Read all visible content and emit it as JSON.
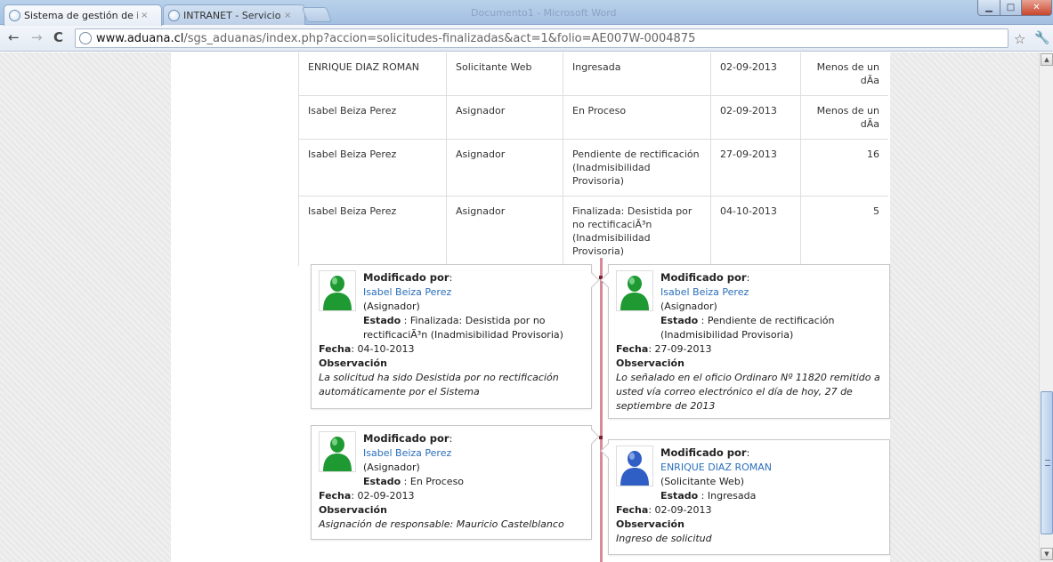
{
  "browser": {
    "tabs": [
      {
        "title": "Sistema de gestión de infor",
        "close": "×"
      },
      {
        "title": "INTRANET - Servicio Nacio",
        "close": "×"
      }
    ],
    "ghost_title": "Documento1 - Microsoft Word",
    "window_controls": {
      "minimize": "▁",
      "maximize": "□",
      "close": "✕"
    },
    "url_domain": "www.aduana.cl",
    "url_path": "/sgs_aduanas/index.php?accion=solicitudes-finalizadas&act=1&folio=AE007W-0004875",
    "icons": [
      "back-icon",
      "forward-icon",
      "reload-icon",
      "globe-icon",
      "star-icon",
      "wrench-icon"
    ]
  },
  "history_table": {
    "rows": [
      {
        "name": "ENRIQUE DIAZ ROMAN",
        "role": "Solicitante Web",
        "state": "Ingresada",
        "date": "02-09-2013",
        "days": "Menos de un dÃ­a"
      },
      {
        "name": "Isabel Beiza Perez",
        "role": "Asignador",
        "state": "En Proceso",
        "date": "02-09-2013",
        "days": "Menos de un dÃ­a"
      },
      {
        "name": "Isabel Beiza Perez",
        "role": "Asignador",
        "state": "Pendiente de rectificación (Inadmisibilidad Provisoria)",
        "date": "27-09-2013",
        "days": "16"
      },
      {
        "name": "Isabel Beiza Perez",
        "role": "Asignador",
        "state": "Finalizada: Desistida por no rectificaciÃ³n (Inadmisibilidad Provisoria)",
        "date": "04-10-2013",
        "days": "5"
      }
    ]
  },
  "timeline": {
    "labels": {
      "modified_by": "Modificado por",
      "estado": "Estado",
      "fecha": "Fecha",
      "observacion": "Observación"
    },
    "entries": [
      {
        "user": "Isabel Beiza Perez",
        "role": "(Asignador)",
        "estado": "Finalizada: Desistida por no rectificaciÃ³n (Inadmisibilidad Provisoria)",
        "fecha": "04-10-2013",
        "observacion": "La solicitud ha sido Desistida por no rectificación automáticamente por el Sistema",
        "avatar": "green-user-icon"
      },
      {
        "user": "Isabel Beiza Perez",
        "role": "(Asignador)",
        "estado": "Pendiente de rectificación (Inadmisibilidad Provisoria)",
        "fecha": "27-09-2013",
        "observacion": "Lo señalado en el oficio Ordinaro Nº 11820 remitido a usted vía correo electrónico el día de hoy, 27 de septiembre de 2013",
        "avatar": "green-user-icon"
      },
      {
        "user": "Isabel Beiza Perez",
        "role": "(Asignador)",
        "estado": "En Proceso",
        "fecha": "02-09-2013",
        "observacion": "Asignación de responsable: Mauricio Castelblanco",
        "avatar": "green-user-icon"
      },
      {
        "user": "ENRIQUE DIAZ ROMAN",
        "role": "(Solicitante Web)",
        "estado": "Ingresada",
        "fecha": "02-09-2013",
        "observacion": "Ingreso de solicitud",
        "avatar": "blue-user-icon"
      }
    ]
  },
  "colors": {
    "link": "#2a6ebb",
    "timeline_line": "#d88a97",
    "green_avatar": "#1f9a33",
    "blue_avatar": "#2f5fc4"
  }
}
